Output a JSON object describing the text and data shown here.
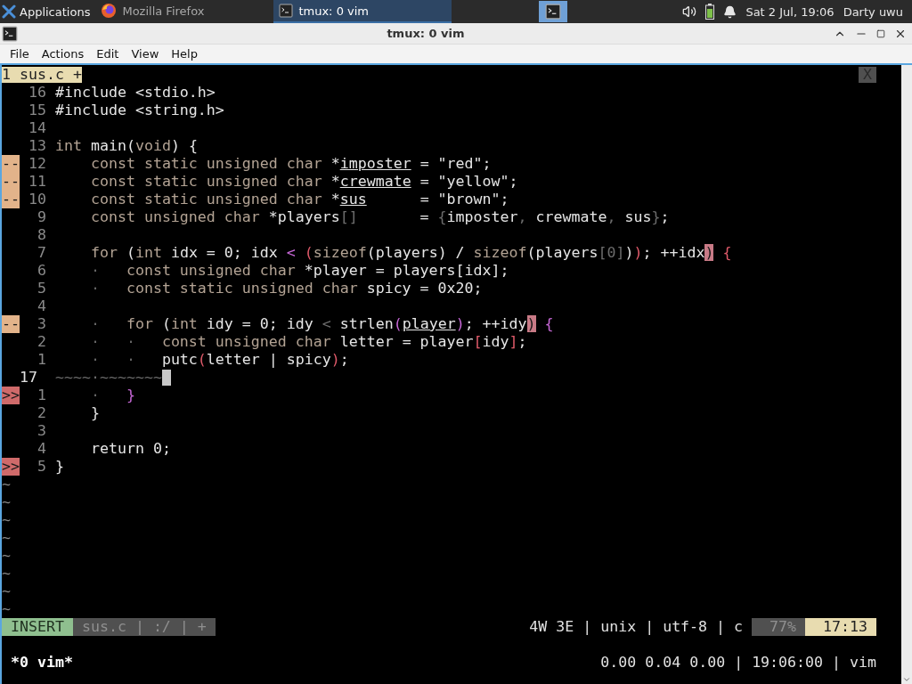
{
  "panel": {
    "apps_label": "Applications",
    "tasks": [
      {
        "label": "Mozilla Firefox",
        "kind": "browser",
        "selected": false
      },
      {
        "label": "tmux: 0 vim",
        "kind": "terminal",
        "selected": true
      }
    ],
    "clock": "Sat  2 Jul, 19:06",
    "user": "Darty uwu"
  },
  "window": {
    "title": "tmux: 0 vim"
  },
  "menu": [
    "File",
    "Actions",
    "Edit",
    "View",
    "Help"
  ],
  "vim": {
    "tab": "1 sus.c +",
    "close": "X",
    "lines": [
      {
        "number": "16",
        "kind": "plain",
        "code": [
          {
            "text": "#include <stdio.h>",
            "kind": "plain"
          }
        ]
      },
      {
        "number": "15",
        "kind": "plain",
        "code": [
          {
            "text": "#include <string.h>",
            "kind": "plain"
          }
        ]
      },
      {
        "number": "14",
        "kind": "plain"
      },
      {
        "number": "13",
        "kind": "plain",
        "code": [
          {
            "text": "int",
            "kind": "keyword"
          },
          {
            "text": " main(",
            "kind": "plain"
          },
          {
            "text": "void",
            "kind": "keyword"
          },
          {
            "text": ") {",
            "kind": "plain"
          }
        ]
      },
      {
        "number": "12",
        "sign": "--",
        "kind": "changed",
        "code": [
          {
            "text": "    const static unsigned char",
            "kind": "keyword"
          },
          {
            "text": " *",
            "kind": "plain"
          },
          {
            "text": "imposter",
            "kind": "underline"
          },
          {
            "text": " = \"red\";",
            "kind": "plain"
          }
        ]
      },
      {
        "number": "11",
        "sign": "--",
        "kind": "changed",
        "code": [
          {
            "text": "    const static unsigned char",
            "kind": "keyword"
          },
          {
            "text": " *",
            "kind": "plain"
          },
          {
            "text": "crewmate",
            "kind": "underline"
          },
          {
            "text": " = \"yellow\";",
            "kind": "plain"
          }
        ]
      },
      {
        "number": "10",
        "sign": "--",
        "kind": "changed",
        "code": [
          {
            "text": "    const static unsigned char",
            "kind": "keyword"
          },
          {
            "text": " *",
            "kind": "plain"
          },
          {
            "text": "sus",
            "kind": "underline"
          },
          {
            "text": "      = \"brown\";",
            "kind": "plain"
          }
        ]
      },
      {
        "number": "9",
        "kind": "plain",
        "code": [
          {
            "text": "    const unsigned char",
            "kind": "keyword"
          },
          {
            "text": " *players",
            "kind": "plain"
          },
          {
            "text": "[]",
            "kind": "dim"
          },
          {
            "text": "       = ",
            "kind": "plain"
          },
          {
            "text": "{",
            "kind": "dim"
          },
          {
            "text": "imposter",
            "kind": "plain"
          },
          {
            "text": ",",
            "kind": "dim"
          },
          {
            "text": " crewmate",
            "kind": "plain"
          },
          {
            "text": ",",
            "kind": "dim"
          },
          {
            "text": " sus",
            "kind": "plain"
          },
          {
            "text": "}",
            "kind": "dim"
          },
          {
            "text": ";",
            "kind": "plain"
          }
        ]
      },
      {
        "number": "8",
        "kind": "plain"
      },
      {
        "number": "7",
        "kind": "plain",
        "code": [
          {
            "text": "    for",
            "kind": "keyword"
          },
          {
            "text": " (",
            "kind": "plain"
          },
          {
            "text": "int",
            "kind": "keyword"
          },
          {
            "text": " idx = 0; idx ",
            "kind": "plain"
          },
          {
            "text": "<",
            "kind": "magenta"
          },
          {
            "text": " (",
            "kind": "red"
          },
          {
            "text": "sizeof",
            "kind": "keyword"
          },
          {
            "text": "(players) / ",
            "kind": "plain"
          },
          {
            "text": "sizeof",
            "kind": "keyword"
          },
          {
            "text": "(players",
            "kind": "plain"
          },
          {
            "text": "[0]",
            "kind": "dim"
          },
          {
            "text": ")",
            "kind": "plain"
          },
          {
            "text": ")",
            "kind": "red"
          },
          {
            "text": "; ++idx",
            "kind": "plain"
          },
          {
            "text": ")",
            "kind": "match"
          },
          {
            "text": " {",
            "kind": "red"
          }
        ]
      },
      {
        "number": "6",
        "kind": "plain",
        "code": [
          {
            "text": "    ·",
            "kind": "indent"
          },
          {
            "text": "   const unsigned char",
            "kind": "keyword"
          },
          {
            "text": " *player = players[idx];",
            "kind": "plain"
          }
        ]
      },
      {
        "number": "5",
        "kind": "plain",
        "code": [
          {
            "text": "    ·",
            "kind": "indent"
          },
          {
            "text": "   const static unsigned char",
            "kind": "keyword"
          },
          {
            "text": " spicy = 0x20;",
            "kind": "plain"
          }
        ]
      },
      {
        "number": "4",
        "kind": "plain"
      },
      {
        "number": "3",
        "sign": "--",
        "kind": "changed",
        "code": [
          {
            "text": "    ·",
            "kind": "indent"
          },
          {
            "text": "   for",
            "kind": "keyword"
          },
          {
            "text": " (",
            "kind": "plain"
          },
          {
            "text": "int",
            "kind": "keyword"
          },
          {
            "text": " idy = 0; idy ",
            "kind": "plain"
          },
          {
            "text": "<",
            "kind": "dim"
          },
          {
            "text": " strlen",
            "kind": "plain"
          },
          {
            "text": "(",
            "kind": "magenta"
          },
          {
            "text": "player",
            "kind": "underline"
          },
          {
            "text": ")",
            "kind": "magenta"
          },
          {
            "text": "; ++idy",
            "kind": "plain"
          },
          {
            "text": ")",
            "kind": "match"
          },
          {
            "text": " {",
            "kind": "magenta"
          }
        ]
      },
      {
        "number": "2",
        "kind": "plain",
        "code": [
          {
            "text": "    ·   ·",
            "kind": "indent"
          },
          {
            "text": "   const unsigned char",
            "kind": "keyword"
          },
          {
            "text": " letter = player",
            "kind": "plain"
          },
          {
            "text": "[",
            "kind": "red"
          },
          {
            "text": "idy",
            "kind": "plain"
          },
          {
            "text": "]",
            "kind": "red"
          },
          {
            "text": ";",
            "kind": "plain"
          }
        ]
      },
      {
        "number": "1",
        "kind": "plain",
        "code": [
          {
            "text": "    ·   ·",
            "kind": "indent"
          },
          {
            "text": "   putc",
            "kind": "plain"
          },
          {
            "text": "(",
            "kind": "red"
          },
          {
            "text": "letter | spicy",
            "kind": "plain"
          },
          {
            "text": ")",
            "kind": "red"
          },
          {
            "text": ";",
            "kind": "plain"
          }
        ]
      },
      {
        "number": "17",
        "kind": "plain",
        "current": true,
        "cursor": true,
        "code": [
          {
            "text": "~~~~·~~~~~~~",
            "kind": "dim"
          }
        ]
      },
      {
        "number": "1",
        "sign": ">>",
        "kind": "error",
        "code": [
          {
            "text": "    ·",
            "kind": "indent"
          },
          {
            "text": "   }",
            "kind": "magenta"
          }
        ]
      },
      {
        "number": "2",
        "kind": "plain",
        "code": [
          {
            "text": "    }",
            "kind": "plain"
          }
        ]
      },
      {
        "number": "3",
        "kind": "plain"
      },
      {
        "number": "4",
        "kind": "plain",
        "code": [
          {
            "text": "    return 0;",
            "kind": "plain"
          }
        ]
      },
      {
        "number": "5",
        "sign": ">>",
        "kind": "error",
        "code": [
          {
            "text": "}",
            "kind": "plain"
          }
        ]
      }
    ],
    "filler": [
      "~",
      "~",
      "~",
      "~",
      "~",
      "~",
      "~",
      "~"
    ],
    "status": {
      "mode": "INSERT",
      "file_info": "sus.c | :/ | +",
      "file_meta": "4W 3E | unix | utf-8 | c",
      "percent": "77%",
      "position": "17:13"
    }
  },
  "tmux": {
    "window": "*0 vim*",
    "right": "0.00 0.04 0.00 | 19:06:00 | vim"
  }
}
